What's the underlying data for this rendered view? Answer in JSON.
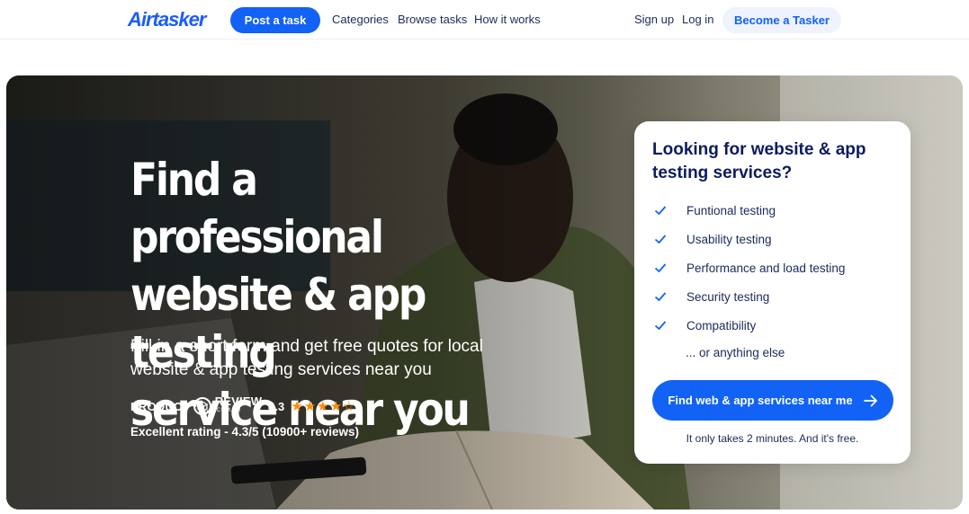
{
  "header": {
    "logo": "Airtasker",
    "post_task": "Post a task",
    "nav": [
      "Categories",
      "Browse tasks",
      "How it works"
    ],
    "sign_up": "Sign up",
    "log_in": "Log in",
    "become_tasker": "Become a Tasker"
  },
  "hero": {
    "headline_lines": [
      "Find a professional",
      "website & app testing",
      "service near you"
    ],
    "subline": "Fill in a short form and get free quotes for local website & app testing services near you",
    "review": {
      "brand_left": "PRODUCT",
      "brand_right": "REVIEW",
      "brand_sub": ".COM.AU",
      "score": "4.3",
      "stars": "★★★★☆",
      "rating_text": "Excellent rating - 4.3/5 (10900+ reviews)"
    }
  },
  "card": {
    "title": "Looking for website & app testing services?",
    "items": [
      "Funtional testing",
      "Usability testing",
      "Performance and load testing",
      "Security testing",
      "Compatibility"
    ],
    "else": "... or anything else",
    "cta": "Find web & app services near me",
    "note": "It only takes 2 minutes. And it's free."
  },
  "colors": {
    "brand_blue": "#1162f5",
    "navy_text": "#0d1b5e",
    "star_orange": "#ff8a00"
  },
  "icons": [
    "check-icon",
    "arrow-right-icon",
    "product-review-badge-icon"
  ]
}
